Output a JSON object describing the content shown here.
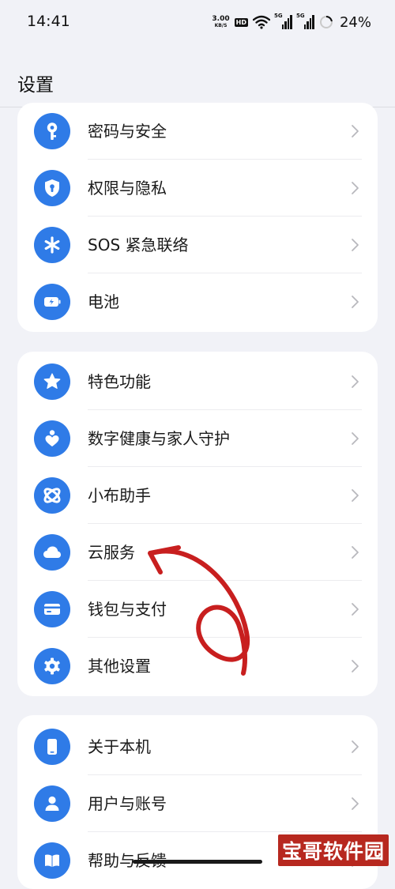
{
  "status_bar": {
    "time": "14:41",
    "net_speed_value": "3.00",
    "net_speed_unit": "KB/S",
    "hd_label": "HD",
    "signal_1_label": "5G",
    "signal_2_label": "5G",
    "battery_percent": "24%"
  },
  "header": {
    "title": "设置"
  },
  "groups": [
    {
      "items": [
        {
          "label": "密码与安全",
          "icon": "key-icon"
        },
        {
          "label": "权限与隐私",
          "icon": "shield-lock-icon"
        },
        {
          "label": "SOS 紧急联络",
          "icon": "asterisk-icon"
        },
        {
          "label": "电池",
          "icon": "battery-icon"
        }
      ]
    },
    {
      "items": [
        {
          "label": "特色功能",
          "icon": "star-icon"
        },
        {
          "label": "数字健康与家人守护",
          "icon": "heart-person-icon"
        },
        {
          "label": "小布助手",
          "icon": "assistant-icon"
        },
        {
          "label": "云服务",
          "icon": "cloud-icon"
        },
        {
          "label": "钱包与支付",
          "icon": "card-icon"
        },
        {
          "label": "其他设置",
          "icon": "gear-icon"
        }
      ]
    },
    {
      "items": [
        {
          "label": "关于本机",
          "icon": "phone-icon"
        },
        {
          "label": "用户与账号",
          "icon": "user-icon"
        },
        {
          "label": "帮助与反馈",
          "icon": "book-icon"
        }
      ]
    }
  ],
  "colors": {
    "accent": "#2f7be7",
    "background": "#f1f2f7",
    "annotation": "#c81f1f",
    "watermark": "#b7281f"
  },
  "watermark": {
    "text": "宝哥软件园"
  }
}
